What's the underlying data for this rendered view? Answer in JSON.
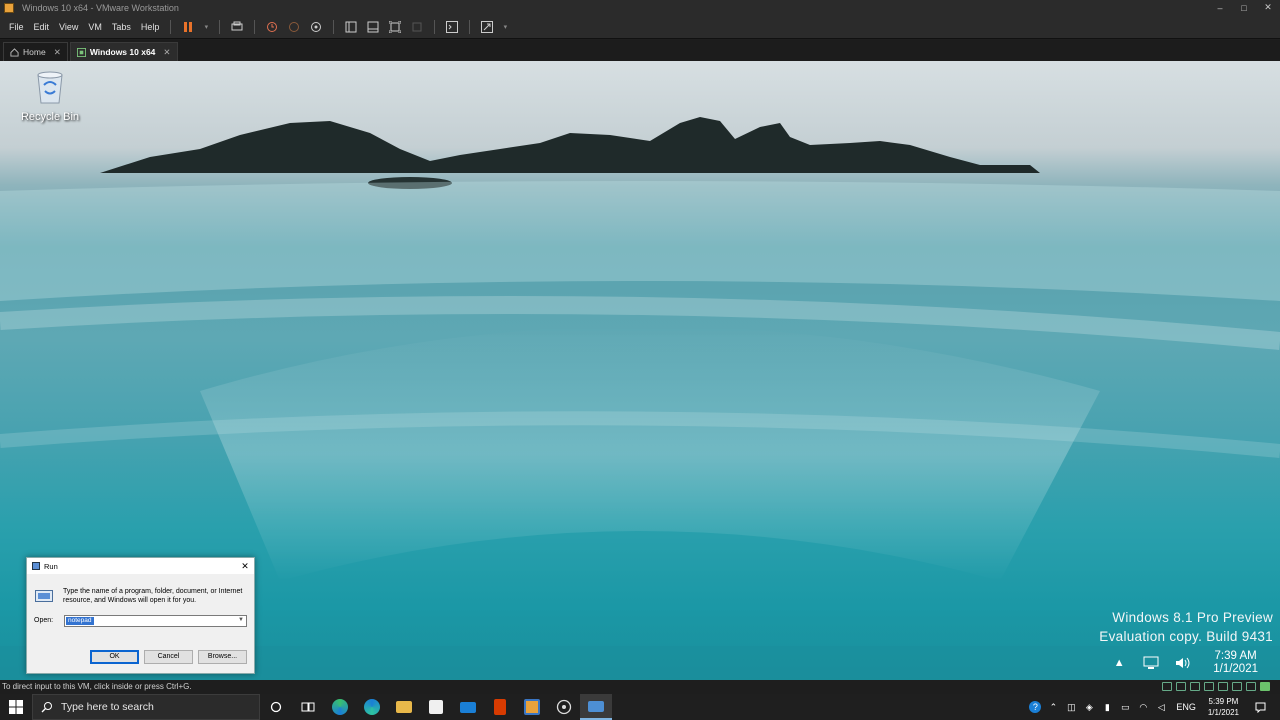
{
  "window": {
    "title": "Windows 10 x64 - VMware Workstation",
    "controls": [
      "–",
      "□",
      "✕"
    ]
  },
  "menu": [
    {
      "label": "File"
    },
    {
      "label": "Edit"
    },
    {
      "label": "View"
    },
    {
      "label": "VM"
    },
    {
      "label": "Tabs"
    },
    {
      "label": "Help"
    }
  ],
  "tabs": [
    {
      "label": "Home",
      "close": "✕"
    },
    {
      "label": "Windows 10 x64",
      "close": "✕"
    }
  ],
  "desktop": {
    "recycle_bin_label": "Recycle Bin",
    "watermark_line1": "Windows 8.1 Pro Preview",
    "watermark_line2": "Evaluation copy. Build 9431",
    "guest_clock_time": "7:39 AM",
    "guest_clock_date": "1/1/2021"
  },
  "run_dialog": {
    "title": "Run",
    "close": "✕",
    "description": "Type the name of a program, folder, document, or Internet resource, and Windows will open it for you.",
    "open_label": "Open:",
    "open_value": "notepad",
    "ok_label": "OK",
    "cancel_label": "Cancel",
    "browse_label": "Browse..."
  },
  "status_line": "To direct input to this VM, click inside or press Ctrl+G.",
  "host_taskbar": {
    "search_placeholder": "Type here to search",
    "language": "ENG",
    "clock_time": "5:39 PM",
    "clock_date": "1/1/2021"
  },
  "colors": {
    "chrome_bg": "#2b2b2b",
    "pause_orange": "#e8722a",
    "sea_teal": "#2aa0ad",
    "selection_blue": "#3373d0"
  }
}
